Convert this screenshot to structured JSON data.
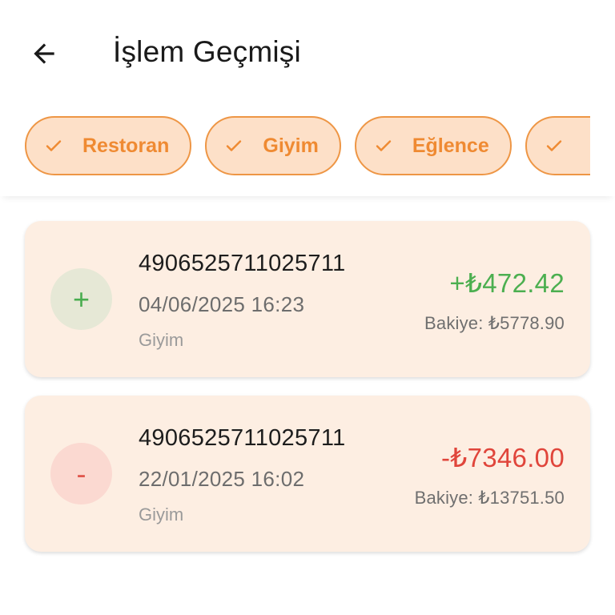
{
  "header": {
    "title": "İşlem Geçmişi",
    "back_icon": "arrow-left-icon"
  },
  "filters": {
    "check_icon": "check-icon",
    "accent_color": "#ef8a32",
    "chip_background": "#fde0c8",
    "chips": [
      {
        "label": "Restoran",
        "selected": true
      },
      {
        "label": "Giyim",
        "selected": true
      },
      {
        "label": "Eğlence",
        "selected": true
      },
      {
        "label": "",
        "selected": true
      }
    ]
  },
  "transactions": [
    {
      "type": "income",
      "icon": "+",
      "number": "4906525711025711",
      "date": "04/06/2025 16:23",
      "category": "Giyim",
      "amount": "+₺472.42",
      "balance": "Bakiye: ₺5778.90",
      "amount_color": "#4caf50"
    },
    {
      "type": "expense",
      "icon": "-",
      "number": "4906525711025711",
      "date": "22/01/2025 16:02",
      "category": "Giyim",
      "amount": "-₺7346.00",
      "balance": "Bakiye: ₺13751.50",
      "amount_color": "#e0453b"
    }
  ]
}
